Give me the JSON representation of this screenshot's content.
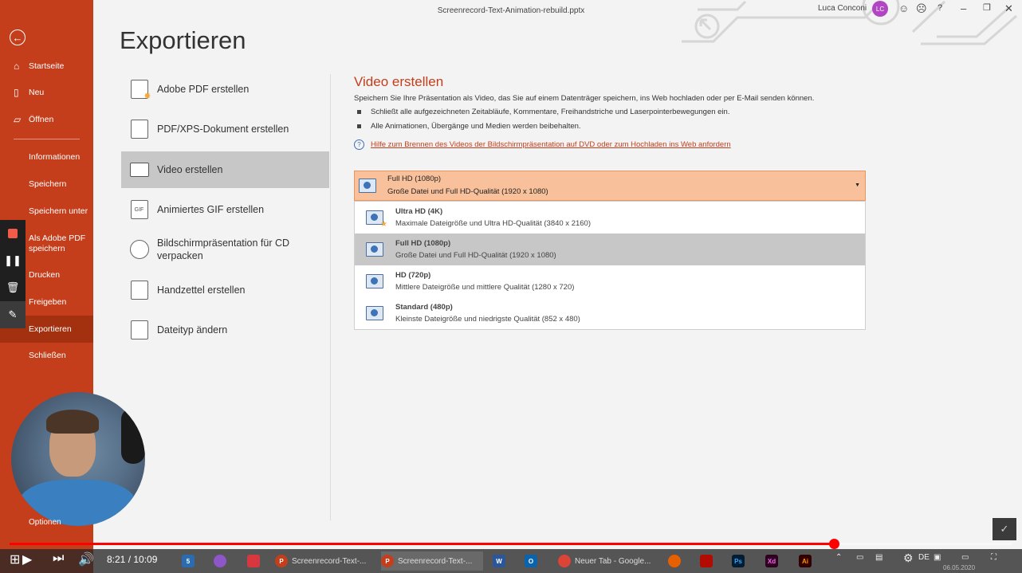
{
  "window": {
    "title": "Screenrecord-Text-Animation-rebuild.pptx",
    "user_name": "Luca Conconi",
    "avatar_initials": "LC"
  },
  "sidebar": {
    "back_icon": "back-arrow-icon",
    "items": [
      {
        "label": "Startseite",
        "icon": "home-icon"
      },
      {
        "label": "Neu",
        "icon": "new-document-icon"
      },
      {
        "label": "Öffnen",
        "icon": "folder-icon"
      },
      {
        "label": "Informationen"
      },
      {
        "label": "Speichern"
      },
      {
        "label": "Speichern unter"
      },
      {
        "label": "Als Adobe PDF speichern"
      },
      {
        "label": "Drucken"
      },
      {
        "label": "Freigeben"
      },
      {
        "label": "Exportieren"
      },
      {
        "label": "Schließen"
      }
    ],
    "options_label": "Optionen",
    "accent": "#c43e1c"
  },
  "main": {
    "heading": "Exportieren",
    "export_options": [
      {
        "label": "Adobe PDF erstellen",
        "icon": "pdf-icon"
      },
      {
        "label": "PDF/XPS-Dokument erstellen",
        "icon": "pdf-xps-icon"
      },
      {
        "label": "Video erstellen",
        "icon": "video-icon"
      },
      {
        "label": "Animiertes GIF erstellen",
        "icon": "gif-icon",
        "icon_text": "GIF"
      },
      {
        "label": "Bildschirmpräsentation für CD verpacken",
        "icon": "cd-icon"
      },
      {
        "label": "Handzettel erstellen",
        "icon": "handout-icon"
      },
      {
        "label": "Dateityp ändern",
        "icon": "filetype-icon"
      }
    ]
  },
  "video_pane": {
    "title": "Video erstellen",
    "description": "Speichern Sie Ihre Präsentation als Video, das Sie auf einem Datenträger speichern, ins Web hochladen oder per E-Mail senden können.",
    "bullets": [
      "Schließt alle aufgezeichneten Zeitabläufe, Kommentare, Freihandstriche und Laserpointerbewegungen ein.",
      "Alle Animationen, Übergänge und Medien werden beibehalten."
    ],
    "help_link": "Hilfe zum Brennen des Videos der Bildschirmpräsentation auf DVD oder zum Hochladen ins Web anfordern",
    "dropdown": {
      "selected_title": "Full HD (1080p)",
      "selected_desc": "Große Datei und Full HD-Qualität (1920 x 1080)",
      "options": [
        {
          "title": "Ultra HD (4K)",
          "desc": "Maximale Dateigröße und Ultra HD-Qualität (3840 x 2160)"
        },
        {
          "title": "Full HD (1080p)",
          "desc": "Große Datei und Full HD-Qualität (1920 x 1080)"
        },
        {
          "title": "HD (720p)",
          "desc": "Mittlere Dateigröße und mittlere Qualität (1280 x 720)"
        },
        {
          "title": "Standard (480p)",
          "desc": "Kleinste Dateigröße und niedrigste Qualität (852 x 480)"
        }
      ]
    }
  },
  "player": {
    "time": "8:21 / 10:09",
    "progress": 0.822
  },
  "taskbar": {
    "apps": [
      {
        "label": "Screenrecord-Text-...",
        "icon": "powerpoint-icon"
      },
      {
        "label": "Screenrecord-Text-...",
        "icon": "powerpoint-icon"
      },
      {
        "label": "Neuer Tab - Google...",
        "icon": "chrome-icon"
      }
    ],
    "mail_badge": "5",
    "tray_lang": "DE",
    "date": "06.05.2020"
  }
}
